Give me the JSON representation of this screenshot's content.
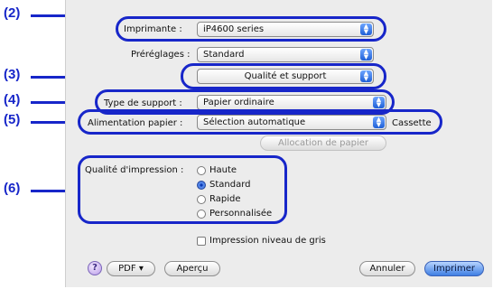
{
  "callouts": [
    "(2)",
    "(3)",
    "(4)",
    "(5)",
    "(6)"
  ],
  "printer": {
    "label": "Imprimante :",
    "value": "iP4600 series"
  },
  "presets": {
    "label": "Préréglages :",
    "value": "Standard"
  },
  "panel": {
    "value": "Qualité et support"
  },
  "media_type": {
    "label": "Type de support :",
    "value": "Papier ordinaire"
  },
  "paper_source": {
    "label": "Alimentation papier :",
    "value": "Sélection automatique",
    "suffix": "Cassette"
  },
  "paper_allocation_button": "Allocation de papier",
  "print_quality": {
    "label": "Qualité d'impression :",
    "options": [
      "Haute",
      "Standard",
      "Rapide",
      "Personnalisée"
    ],
    "selected": "Standard"
  },
  "grayscale": {
    "label": "Impression niveau de gris",
    "checked": false
  },
  "footer": {
    "help": "?",
    "pdf": "PDF ▾",
    "preview": "Aperçu",
    "cancel": "Annuler",
    "print": "Imprimer"
  },
  "colors": {
    "callout": "#1726c9",
    "dialog_bg": "#ececec",
    "default_button": "#3f7fe3"
  }
}
